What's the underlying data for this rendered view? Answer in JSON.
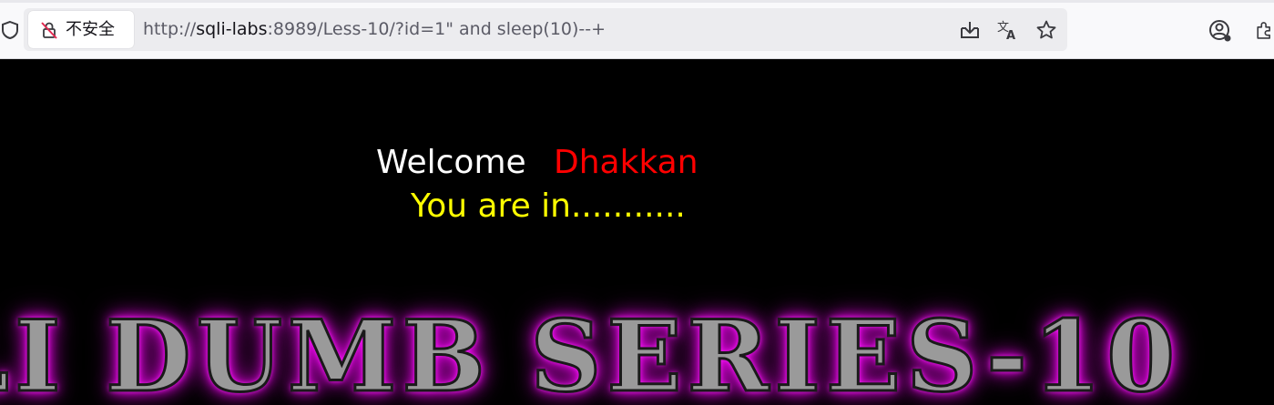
{
  "browser": {
    "security_label": "不安全",
    "url_scheme": "http://",
    "url_host": "sqli-labs",
    "url_rest": ":8989/Less-10/?id=1\" and sleep(10)--+",
    "icons": [
      "shield-icon",
      "insecure-lock-icon",
      "download-icon",
      "translate-icon",
      "bookmark-star-icon",
      "account-icon",
      "extensions-icon"
    ]
  },
  "page": {
    "welcome_label": "Welcome",
    "user_name": "Dhakkan",
    "status_message": "You are in...........",
    "banner_text": "LI DUMB SERIES-10",
    "colors": {
      "background": "#000000",
      "welcome": "#ffffff",
      "name": "#ff0000",
      "status": "#ffff00",
      "banner_glow": "#ff00ff"
    }
  }
}
